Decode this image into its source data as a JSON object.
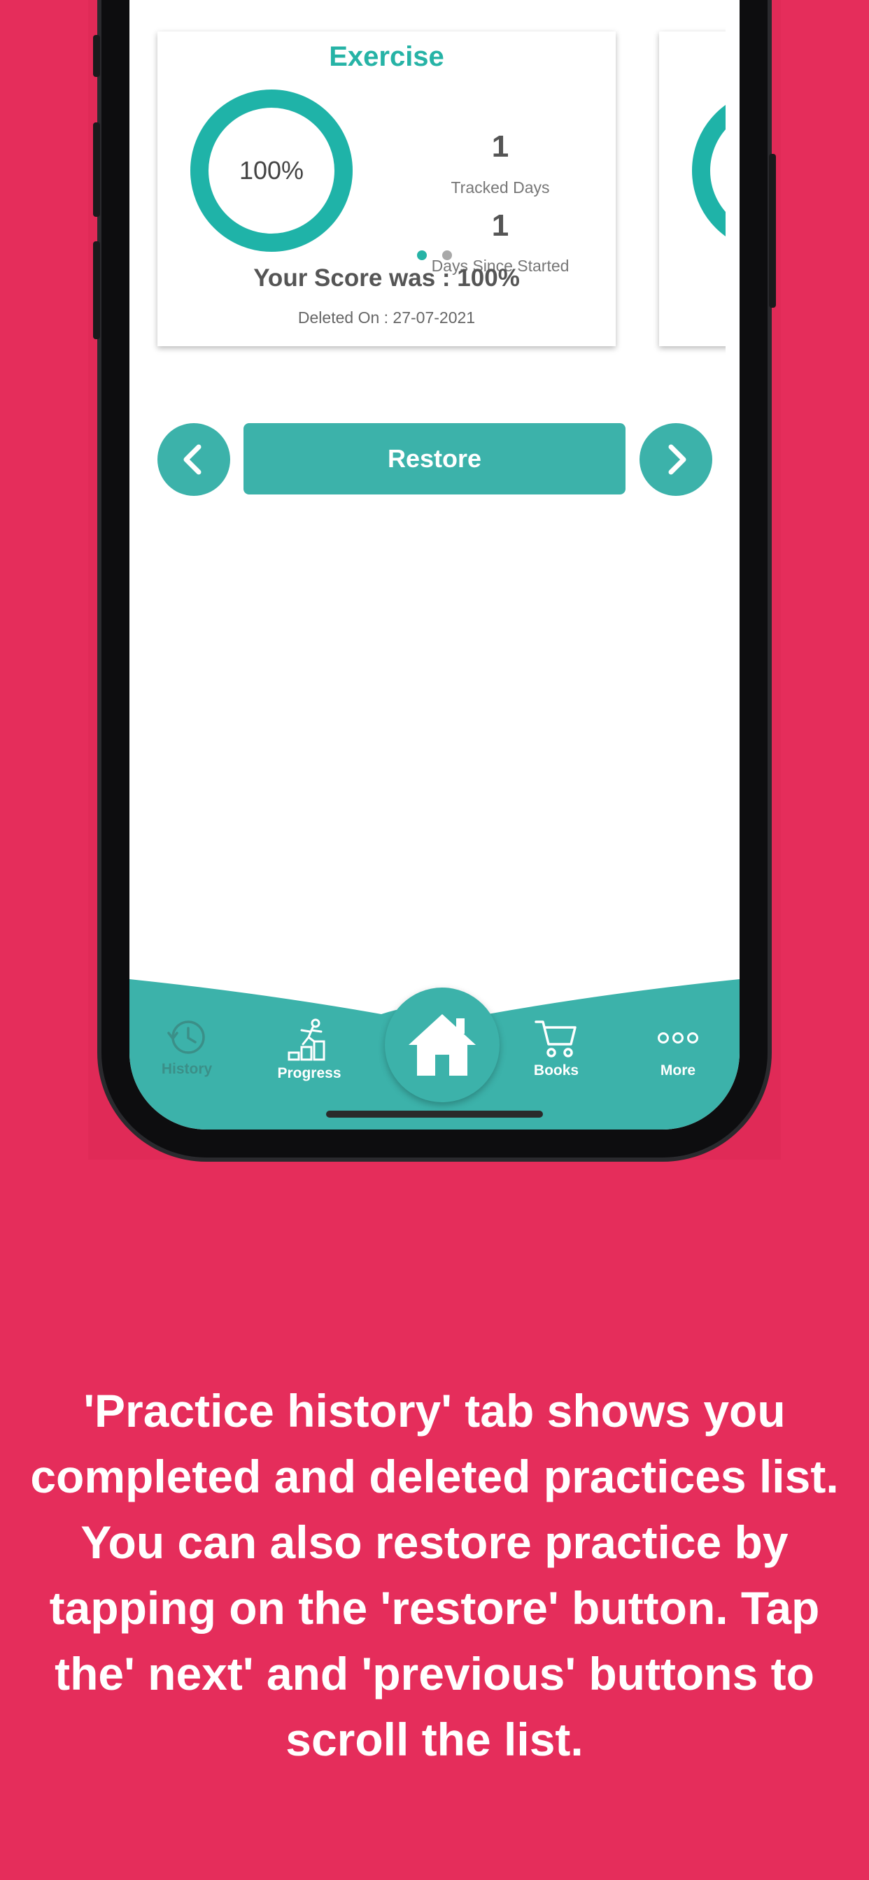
{
  "card": {
    "title": "Exercise",
    "percent_label": "100%",
    "progress_fraction": 1.0,
    "tracked_days_value": "1",
    "tracked_days_label": "Tracked Days",
    "days_since_value": "1",
    "days_since_label": "Days Since Started",
    "score_text": "Your Score was : 100%",
    "deleted_text": "Deleted On : 27-07-2021"
  },
  "pager": {
    "pages": 2,
    "active_index": 0
  },
  "actions": {
    "restore_label": "Restore",
    "previous_icon": "chevron-left-icon",
    "next_icon": "chevron-right-icon"
  },
  "tabbar": {
    "items": [
      {
        "label": "History",
        "icon": "history-icon",
        "active": false
      },
      {
        "label": "Progress",
        "icon": "progress-stairs-icon",
        "active": true
      },
      {
        "label": "Home",
        "icon": "home-icon",
        "active": true
      },
      {
        "label": "Books",
        "icon": "cart-icon",
        "active": true
      },
      {
        "label": "More",
        "icon": "more-dots-icon",
        "active": true
      }
    ]
  },
  "caption": "'Practice history' tab shows you completed and deleted practices list. You can also restore practice by tapping on the 'restore' button. Tap the' next' and 'previous' buttons to scroll the list.",
  "colors": {
    "background": "#e52d5b",
    "accent": "#3cb2aa",
    "title_teal": "#26b3a6",
    "dot_inactive": "#a8a8a8"
  }
}
